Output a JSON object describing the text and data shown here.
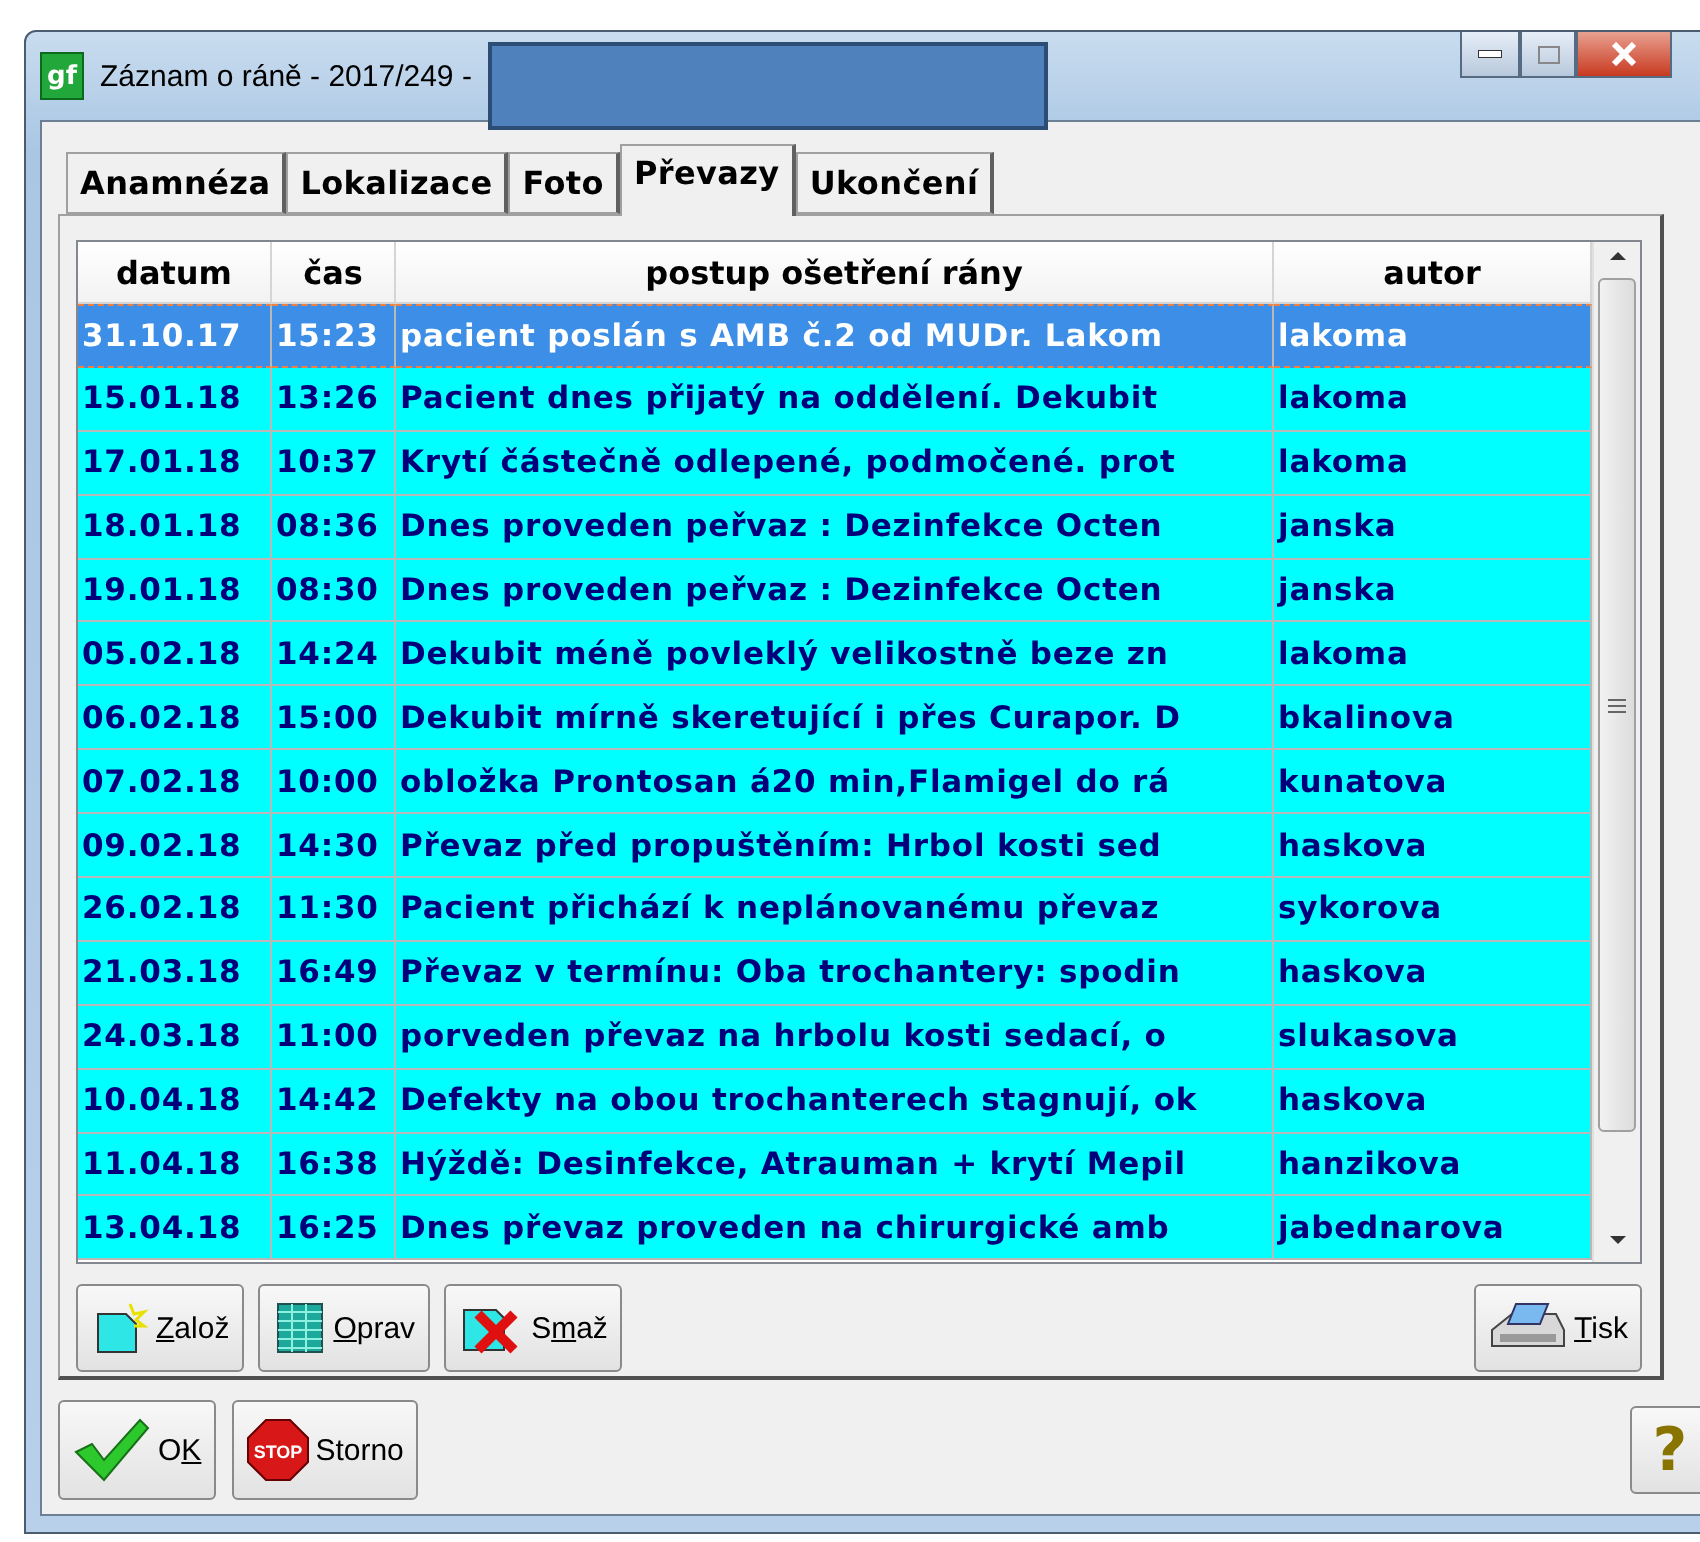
{
  "window": {
    "icon_text": "gf",
    "title": "Záznam o ráně - 2017/249 -"
  },
  "tabs": [
    {
      "label": "Anamnéza",
      "selected": false
    },
    {
      "label": "Lokalizace",
      "selected": false
    },
    {
      "label": "Foto",
      "selected": false
    },
    {
      "label": "Převazy",
      "selected": true
    },
    {
      "label": "Ukončení",
      "selected": false
    }
  ],
  "table": {
    "columns": [
      "datum",
      "čas",
      "postup ošetření rány",
      "autor"
    ],
    "rows": [
      {
        "cells": [
          "31.10.17",
          "15:23",
          "pacient poslán s AMB č.2 od MUDr. Lakom",
          "lakoma"
        ],
        "selected": true
      },
      {
        "cells": [
          "15.01.18",
          "13:26",
          "Pacient dnes přijatý na oddělení. Dekubit",
          "lakoma"
        ],
        "selected": false
      },
      {
        "cells": [
          "17.01.18",
          "10:37",
          "Krytí částečně odlepené, podmočené. prot",
          "lakoma"
        ],
        "selected": false
      },
      {
        "cells": [
          "18.01.18",
          "08:36",
          "Dnes proveden peřvaz : Dezinfekce Octen",
          "janska"
        ],
        "selected": false
      },
      {
        "cells": [
          "19.01.18",
          "08:30",
          "Dnes proveden peřvaz : Dezinfekce Octen",
          "janska"
        ],
        "selected": false
      },
      {
        "cells": [
          "05.02.18",
          "14:24",
          "Dekubit méně povleklý velikostně beze zn",
          "lakoma"
        ],
        "selected": false
      },
      {
        "cells": [
          "06.02.18",
          "15:00",
          "Dekubit mírně skeretující i přes Curapor. D",
          "bkalinova"
        ],
        "selected": false
      },
      {
        "cells": [
          "07.02.18",
          "10:00",
          "obložka Prontosan á20 min,Flamigel do rá",
          "kunatova"
        ],
        "selected": false
      },
      {
        "cells": [
          "09.02.18",
          "14:30",
          "Převaz před propuštěním: Hrbol kosti sed",
          "haskova"
        ],
        "selected": false
      },
      {
        "cells": [
          "26.02.18",
          "11:30",
          "Pacient přichází k neplánovanému převaz",
          "sykorova"
        ],
        "selected": false
      },
      {
        "cells": [
          "21.03.18",
          "16:49",
          "Převaz v termínu: Oba trochantery: spodin",
          "haskova"
        ],
        "selected": false
      },
      {
        "cells": [
          "24.03.18",
          "11:00",
          "porveden převaz na hrbolu kosti sedací, o",
          "slukasova"
        ],
        "selected": false
      },
      {
        "cells": [
          "10.04.18",
          "14:42",
          "Defekty na obou trochanterech stagnují, ok",
          "haskova"
        ],
        "selected": false
      },
      {
        "cells": [
          "11.04.18",
          "16:38",
          "Hýždě: Desinfekce, Atrauman + krytí Mepil",
          "hanzikova"
        ],
        "selected": false
      },
      {
        "cells": [
          "13.04.18",
          "16:25",
          "Dnes převaz proveden na chirurgické amb",
          "jabednarova"
        ],
        "selected": false
      }
    ]
  },
  "record_buttons": [
    {
      "kind": "new",
      "label": {
        "key": "Z",
        "post": "alož"
      }
    },
    {
      "kind": "edit",
      "label": {
        "key": "O",
        "post": "prav"
      }
    },
    {
      "kind": "delete",
      "label": {
        "pre": "S",
        "key": "m",
        "post": "až"
      }
    },
    {
      "kind": "print",
      "label": {
        "key": "T",
        "post": "isk"
      }
    }
  ],
  "dialog_buttons": [
    {
      "kind": "ok",
      "label": {
        "pre": "O",
        "key": "K"
      }
    },
    {
      "kind": "cancel",
      "label": {
        "pre": "Storno"
      },
      "icon_text": "STOP"
    }
  ],
  "help": "?"
}
